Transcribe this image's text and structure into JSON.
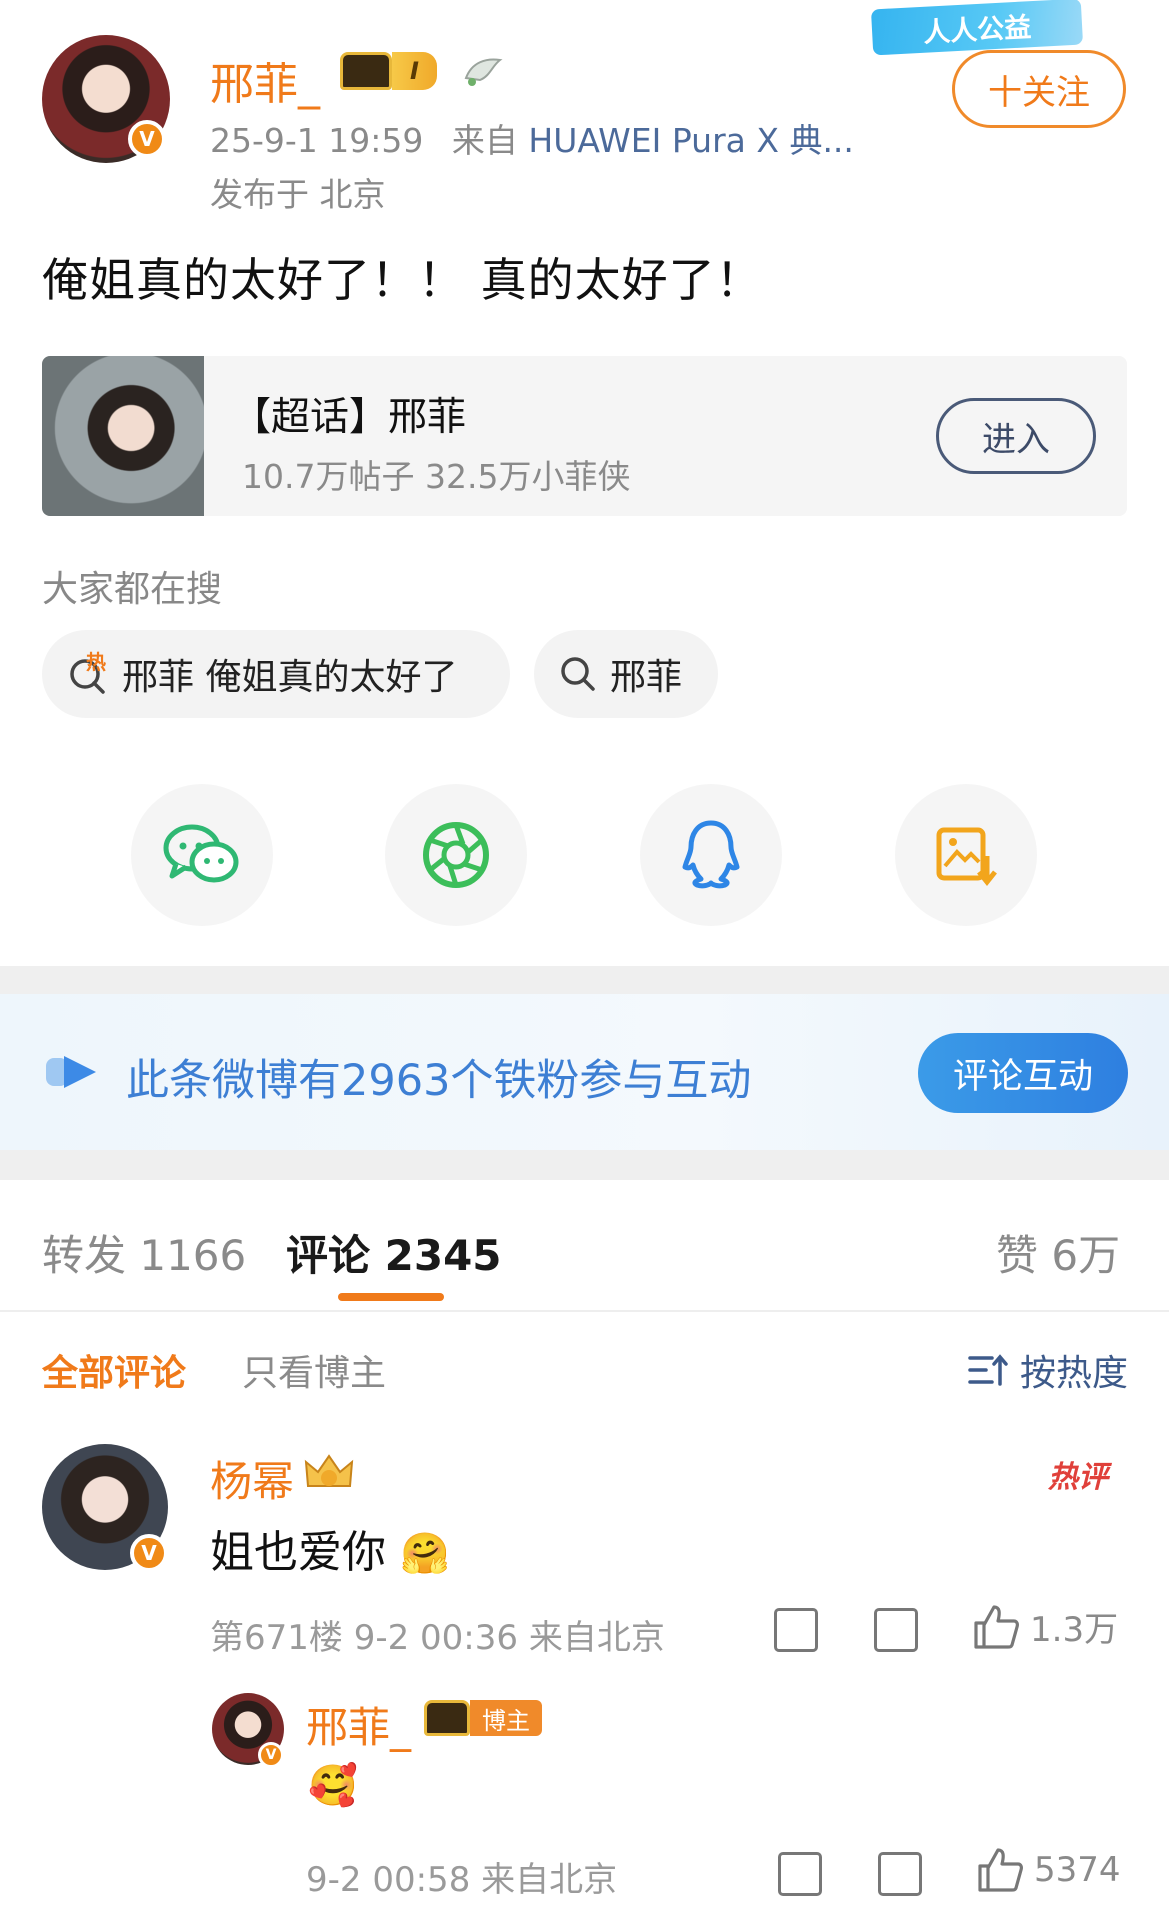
{
  "post": {
    "username": "邢菲_",
    "level_badge": "I",
    "timestamp": "25-9-1 19:59",
    "source_prefix": "来自",
    "device": "HUAWEI Pura X 典...",
    "location": "发布于 北京",
    "text": "俺姐真的太好了！！ 真的太好了！",
    "follow_label": "十关注",
    "promo_banner": "人人公益"
  },
  "supertopic": {
    "title": "【超话】邢菲",
    "stats": "10.7万帖子 32.5万小菲侠",
    "enter_label": "进入"
  },
  "search": {
    "label": "大家都在搜",
    "chips": [
      {
        "badge": "热",
        "text": "邢菲 俺姐真的太好了"
      },
      {
        "text": "邢菲"
      }
    ]
  },
  "share": {
    "icons": [
      "wechat-icon",
      "moments-icon",
      "qq-icon",
      "save-image-icon"
    ]
  },
  "fan_banner": {
    "text": "此条微博有2963个铁粉参与互动",
    "button_label": "评论互动"
  },
  "tabs": {
    "repost": "转发 1166",
    "comments": "评论 2345",
    "likes": "赞 6万"
  },
  "filters": {
    "all": "全部评论",
    "blogger_only": "只看博主",
    "sort": "按热度"
  },
  "comments": [
    {
      "username": "杨幂",
      "text": "姐也爱你",
      "emoji": "🤗",
      "hot_label": "热评",
      "meta": "第671楼 9-2 00:36 来自北京",
      "likes": "1.3万",
      "reply": {
        "username": "邢菲_",
        "tag": "博主",
        "emoji": "🥰",
        "meta": "9-2 00:58 来自北京",
        "likes": "5374"
      }
    }
  ],
  "colors": {
    "accent": "#f07a1a",
    "link": "#3d7fd4",
    "muted": "#8a8a8a"
  }
}
